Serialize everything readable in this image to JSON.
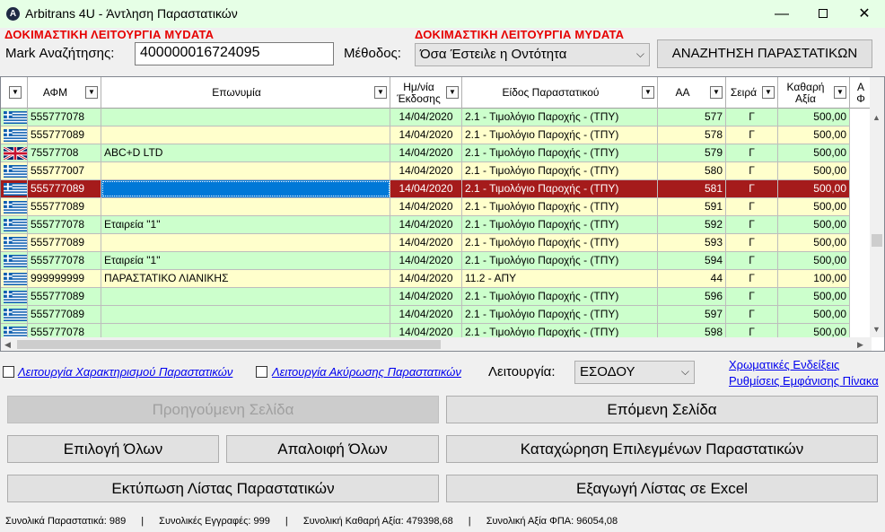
{
  "window": {
    "title": "Arbitrans 4U - Άντληση Παραστατικών",
    "app_icon_glyph": "A"
  },
  "header": {
    "demo_label_left": "ΔΟΚΙΜΑΣΤΙΚΗ ΛΕΙΤΟΥΡΓΙΑ MYDATA",
    "demo_label_right": "ΔΟΚΙΜΑΣΤΙΚΗ ΛΕΙΤΟΥΡΓΙΑ MYDATA",
    "mark_label": "Mark Αναζήτησης:",
    "mark_value": "400000016724095",
    "method_label": "Μέθοδος:",
    "method_value": "Όσα Έστειλε η Οντότητα",
    "search_button": "ΑΝΑΖΗΤΗΣΗ ΠΑΡΑΣΤΑΤΙΚΩΝ"
  },
  "grid": {
    "columns": [
      "ΑΦΜ",
      "Επωνυμία",
      "Ημ/νία Έκδοσης",
      "Είδος Παραστατικού",
      "ΑΑ",
      "Σειρά",
      "Καθαρή Αξία",
      "Α Φ"
    ],
    "rows": [
      {
        "flag": "gr",
        "afm": "555777078",
        "name": "",
        "date": "14/04/2020",
        "type": "2.1 - Τιμολόγιο Παροχής - (ΤΠΥ)",
        "aa": "577",
        "series": "Γ",
        "net": "500,00",
        "color": "green"
      },
      {
        "flag": "gr",
        "afm": "555777089",
        "name": "",
        "date": "14/04/2020",
        "type": "2.1 - Τιμολόγιο Παροχής - (ΤΠΥ)",
        "aa": "578",
        "series": "Γ",
        "net": "500,00",
        "color": "yellow"
      },
      {
        "flag": "gb",
        "afm": "75577708",
        "name": "ABC+D LTD",
        "date": "14/04/2020",
        "type": "2.1 - Τιμολόγιο Παροχής - (ΤΠΥ)",
        "aa": "579",
        "series": "Γ",
        "net": "500,00",
        "color": "green"
      },
      {
        "flag": "gr",
        "afm": "555777007",
        "name": "",
        "date": "14/04/2020",
        "type": "2.1 - Τιμολόγιο Παροχής - (ΤΠΥ)",
        "aa": "580",
        "series": "Γ",
        "net": "500,00",
        "color": "yellow"
      },
      {
        "flag": "gr",
        "afm": "555777089",
        "name": "",
        "date": "14/04/2020",
        "type": "2.1 - Τιμολόγιο Παροχής - (ΤΠΥ)",
        "aa": "581",
        "series": "Γ",
        "net": "500,00",
        "color": "selected"
      },
      {
        "flag": "gr",
        "afm": "555777089",
        "name": "",
        "date": "14/04/2020",
        "type": "2.1 - Τιμολόγιο Παροχής - (ΤΠΥ)",
        "aa": "591",
        "series": "Γ",
        "net": "500,00",
        "color": "yellow"
      },
      {
        "flag": "gr",
        "afm": "555777078",
        "name": "Εταιρεία \"1\"",
        "date": "14/04/2020",
        "type": "2.1 - Τιμολόγιο Παροχής - (ΤΠΥ)",
        "aa": "592",
        "series": "Γ",
        "net": "500,00",
        "color": "green"
      },
      {
        "flag": "gr",
        "afm": "555777089",
        "name": "",
        "date": "14/04/2020",
        "type": "2.1 - Τιμολόγιο Παροχής - (ΤΠΥ)",
        "aa": "593",
        "series": "Γ",
        "net": "500,00",
        "color": "yellow"
      },
      {
        "flag": "gr",
        "afm": "555777078",
        "name": "Εταιρεία \"1\"",
        "date": "14/04/2020",
        "type": "2.1 - Τιμολόγιο Παροχής - (ΤΠΥ)",
        "aa": "594",
        "series": "Γ",
        "net": "500,00",
        "color": "green"
      },
      {
        "flag": "gr",
        "afm": "999999999",
        "name": "ΠΑΡΑΣΤΑΤΙΚΟ ΛΙΑΝΙΚΗΣ",
        "date": "14/04/2020",
        "type": "11.2 - ΑΠΥ",
        "aa": "44",
        "series": "Γ",
        "net": "100,00",
        "color": "yellow"
      },
      {
        "flag": "gr",
        "afm": "555777089",
        "name": "",
        "date": "14/04/2020",
        "type": "2.1 - Τιμολόγιο Παροχής - (ΤΠΥ)",
        "aa": "596",
        "series": "Γ",
        "net": "500,00",
        "color": "green"
      },
      {
        "flag": "gr",
        "afm": "555777089",
        "name": "",
        "date": "14/04/2020",
        "type": "2.1 - Τιμολόγιο Παροχής - (ΤΠΥ)",
        "aa": "597",
        "series": "Γ",
        "net": "500,00",
        "color": "green"
      },
      {
        "flag": "gr",
        "afm": "555777078",
        "name": "",
        "date": "14/04/2020",
        "type": "2.1 - Τιμολόγιο Παροχής - (ΤΠΥ)",
        "aa": "598",
        "series": "Γ",
        "net": "500,00",
        "color": "green"
      }
    ]
  },
  "options": {
    "characterization_link": "Λειτουργία Χαρακτηρισμού Παραστατικών",
    "cancellation_link": "Λειτουργία Ακύρωσης Παραστατικών",
    "operation_label": "Λειτουργία:",
    "operation_value": "ΕΣΟΔΟΥ",
    "color_legend_link": "Χρωματικές Ενδείξεις",
    "table_settings_link": "Ρυθμίσεις Εμφάνισης Πίνακα"
  },
  "buttons": {
    "prev_page": "Προηγούμενη Σελίδα",
    "next_page": "Επόμενη Σελίδα",
    "select_all": "Επιλογή Όλων",
    "clear_all": "Απαλοιφή Όλων",
    "save_selected": "Καταχώρηση Επιλεγμένων Παραστατικών",
    "print_list": "Εκτύπωση Λίστας Παραστατικών",
    "export_excel": "Εξαγωγή Λίστας σε Excel"
  },
  "status": {
    "total_docs": "Συνολικά Παραστατικά:  989",
    "total_records": "Συνολικές Εγγραφές:  999",
    "total_net": "Συνολική Καθαρή Αξία:  479398,68",
    "total_vat": "Συνολική Αξία ΦΠΑ:  96054,08",
    "separator": "|"
  },
  "colors": {
    "title_bg": "#e6ffe6",
    "row_green": "#ccffcc",
    "row_yellow": "#ffffcc",
    "row_selected": "#a51b1b",
    "demo_red": "#e60000"
  }
}
